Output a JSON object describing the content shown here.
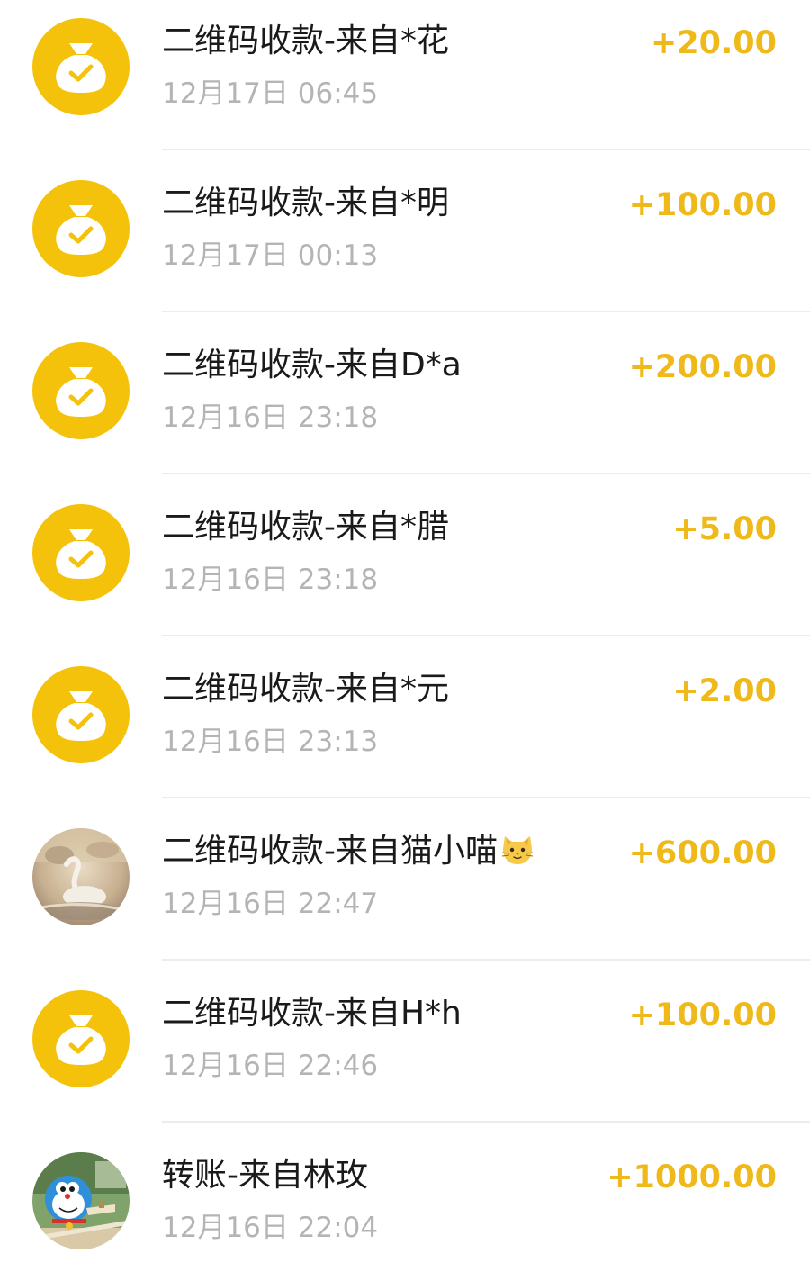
{
  "transactions": [
    {
      "title": "二维码收款-来自*花",
      "time": "12月17日 06:45",
      "amount": "+20.00",
      "avatar": "money-bag-icon"
    },
    {
      "title": "二维码收款-来自*明",
      "time": "12月17日 00:13",
      "amount": "+100.00",
      "avatar": "money-bag-icon"
    },
    {
      "title": "二维码收款-来自D*a",
      "time": "12月16日 23:18",
      "amount": "+200.00",
      "avatar": "money-bag-icon"
    },
    {
      "title": "二维码收款-来自*腊",
      "time": "12月16日 23:18",
      "amount": "+5.00",
      "avatar": "money-bag-icon"
    },
    {
      "title": "二维码收款-来自*元",
      "time": "12月16日 23:13",
      "amount": "+2.00",
      "avatar": "money-bag-icon"
    },
    {
      "title": "二维码收款-来自猫小喵",
      "time": "12月16日 22:47",
      "amount": "+600.00",
      "avatar": "user-photo-swan",
      "emoji": "cat-face-emoji"
    },
    {
      "title": "二维码收款-来自H*h",
      "time": "12月16日 22:46",
      "amount": "+100.00",
      "avatar": "money-bag-icon"
    },
    {
      "title": "转账-来自林玫",
      "time": "12月16日 22:04",
      "amount": "+1000.00",
      "avatar": "user-photo-doraemon"
    }
  ],
  "colors": {
    "coin_yellow": "#f5c20b",
    "amount_yellow": "#f0b91a",
    "title_text": "#1a1a1a",
    "time_text": "#b4b4b4",
    "divider": "#ececec"
  }
}
